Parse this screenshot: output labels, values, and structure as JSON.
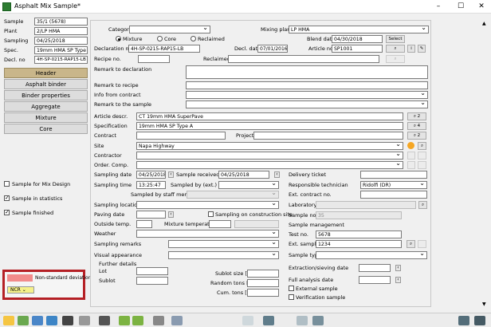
{
  "window": {
    "title": "Asphalt Mix Sample*",
    "minimize": "–",
    "maximize": "☐",
    "close": "✕"
  },
  "sidebar": {
    "fields": [
      {
        "label": "Sample",
        "value": "35/1 (5678)"
      },
      {
        "label": "Plant",
        "value": "2/LP HMA"
      },
      {
        "label": "Sampling",
        "value": "04/25/2018"
      },
      {
        "label": "Spec.",
        "value": "19mm HMA SP Type A"
      },
      {
        "label": "Decl. no",
        "value": "4H-SP-0215-RAP15-LB"
      }
    ],
    "nav": [
      "Header",
      "Asphalt binder",
      "Binder properties",
      "Aggregate",
      "Mixture",
      "Core"
    ],
    "checks": [
      {
        "label": "Sample for Mix Design",
        "checked": false
      },
      {
        "label": "Sample in statistics",
        "checked": true
      },
      {
        "label": "Sample finished",
        "checked": true
      }
    ],
    "legend": {
      "nonstandard": "Non-standard deviations",
      "ncr": "NCR"
    }
  },
  "form": {
    "category": "Category",
    "mixing_plant": "Mixing plant",
    "mixing_plant_value": "LP HMA",
    "radios": [
      "Mixture",
      "Core",
      "Reclaimed"
    ],
    "blend_date": "Blend date",
    "blend_date_value": "04/30/2018",
    "select_btn": "Select",
    "declaration_no": "Declaration no.",
    "declaration_no_value": "4H-SP-0215-RAP15-LB",
    "decl_date": "Decl. date",
    "decl_date_value": "07/01/2016",
    "article_no": "Article no.",
    "article_no_value": "SP1001",
    "recipe_no": "Recipe no.",
    "reclaimed": "Reclaimed",
    "remark_decl": "Remark to declaration",
    "remark_recipe": "Remark to recipe",
    "info_contract": "Info from contract",
    "remark_sample": "Remark to the sample",
    "article_descr": "Article descr.",
    "article_descr_value": "CT 19mm HMA SuperPave",
    "specification": "Specification",
    "specification_value": "19mm HMA SP Type A",
    "contract": "Contract",
    "project": "Project",
    "site": "Site",
    "site_value": "Napa Highway",
    "contractor": "Contractor",
    "order_comp": "Order. Comp.",
    "sampling_date": "Sampling date",
    "sampling_date_value": "04/25/2018",
    "sample_received": "Sample received",
    "sample_received_value": "04/25/2018",
    "delivery_ticket": "Delivery ticket",
    "sampling_time": "Sampling time",
    "sampling_time_value": "13:25:47",
    "sampled_by_ext": "Sampled by (ext.)",
    "responsible_technician": "Responsible technician",
    "technician_value": "Ridolfi (DR)",
    "sampled_by_staff": "Sampled by staff member",
    "ext_contract_no": "Ext. contract no.",
    "sampling_location": "Sampling location",
    "laboratory": "Laboratory",
    "paving_date": "Paving date",
    "sampling_site": "Sampling on construction site",
    "sample_no": "Sample no.",
    "sample_no_value": "35",
    "outside_temp": "Outside temp.",
    "mixture_temp": "Mixture temperature",
    "sample_mgmt": "Sample management",
    "weather": "Weather",
    "test_no": "Test no.",
    "test_no_value": "5678",
    "sampling_remarks": "Sampling remarks",
    "ext_sample": "Ext. sample",
    "ext_sample_value": "1234",
    "visual_appearance": "Visual appearance",
    "sample_type": "Sample type",
    "further_details": "Further details",
    "lot": "Lot",
    "sublot": "Sublot",
    "sublot_size": "Sublot size [t]",
    "extraction_date": "Extraction/sieving date",
    "random_tons": "Random tons [t]",
    "full_analysis_date": "Full analysis date",
    "external_sample": "External sample",
    "cum_tons": "Cum. tons [t]",
    "verification_sample": "Verification sample",
    "side_counts": [
      "2",
      "4",
      "2"
    ]
  },
  "colors": {
    "nav_active": "#c9b68a",
    "nonstandard": "#f28b8b",
    "ncr": "#f5f08a",
    "highlight": "#b52025"
  }
}
